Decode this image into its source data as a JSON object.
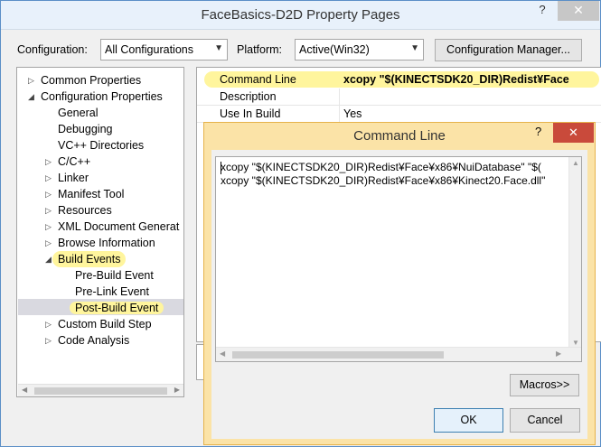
{
  "window": {
    "title": "FaceBasics-D2D Property Pages",
    "help_glyph": "?",
    "close_glyph": "✕"
  },
  "config_bar": {
    "configuration_label": "Configuration:",
    "configuration_value": "All Configurations",
    "platform_label": "Platform:",
    "platform_value": "Active(Win32)",
    "config_manager_label": "Configuration Manager..."
  },
  "tree": {
    "items": [
      {
        "label": "Common Properties",
        "toggle": "▷"
      },
      {
        "label": "Configuration Properties",
        "toggle": "◢"
      },
      {
        "label": "General",
        "toggle": ""
      },
      {
        "label": "Debugging",
        "toggle": ""
      },
      {
        "label": "VC++ Directories",
        "toggle": ""
      },
      {
        "label": "C/C++",
        "toggle": "▷"
      },
      {
        "label": "Linker",
        "toggle": "▷"
      },
      {
        "label": "Manifest Tool",
        "toggle": "▷"
      },
      {
        "label": "Resources",
        "toggle": "▷"
      },
      {
        "label": "XML Document Generat",
        "toggle": "▷"
      },
      {
        "label": "Browse Information",
        "toggle": "▷"
      },
      {
        "label": "Build Events",
        "toggle": "◢"
      },
      {
        "label": "Pre-Build Event",
        "toggle": ""
      },
      {
        "label": "Pre-Link Event",
        "toggle": ""
      },
      {
        "label": "Post-Build Event",
        "toggle": ""
      },
      {
        "label": "Custom Build Step",
        "toggle": "▷"
      },
      {
        "label": "Code Analysis",
        "toggle": "▷"
      }
    ],
    "scroll_left": "◀",
    "scroll_right": "▶"
  },
  "grid": {
    "rows": [
      {
        "name": "Command Line",
        "value": "xcopy \"$(KINECTSDK20_DIR)Redist¥Face"
      },
      {
        "name": "Description",
        "value": ""
      },
      {
        "name": "Use In Build",
        "value": "Yes"
      }
    ]
  },
  "dialog": {
    "title": "Command Line",
    "help_glyph": "?",
    "close_glyph": "✕",
    "lines": [
      "xcopy \"$(KINECTSDK20_DIR)Redist¥Face¥x86¥NuiDatabase\" \"$(",
      "xcopy \"$(KINECTSDK20_DIR)Redist¥Face¥x86¥Kinect20.Face.dll\""
    ],
    "macros_label": "Macros>>",
    "ok_label": "OK",
    "cancel_label": "Cancel",
    "scroll_up": "▲",
    "scroll_down": "▼",
    "scroll_left": "◀",
    "scroll_right": "▶"
  },
  "colors": {
    "highlight": "#fff59d",
    "dialog_frame": "#fbe3a7",
    "close_red": "#c94a3b"
  }
}
